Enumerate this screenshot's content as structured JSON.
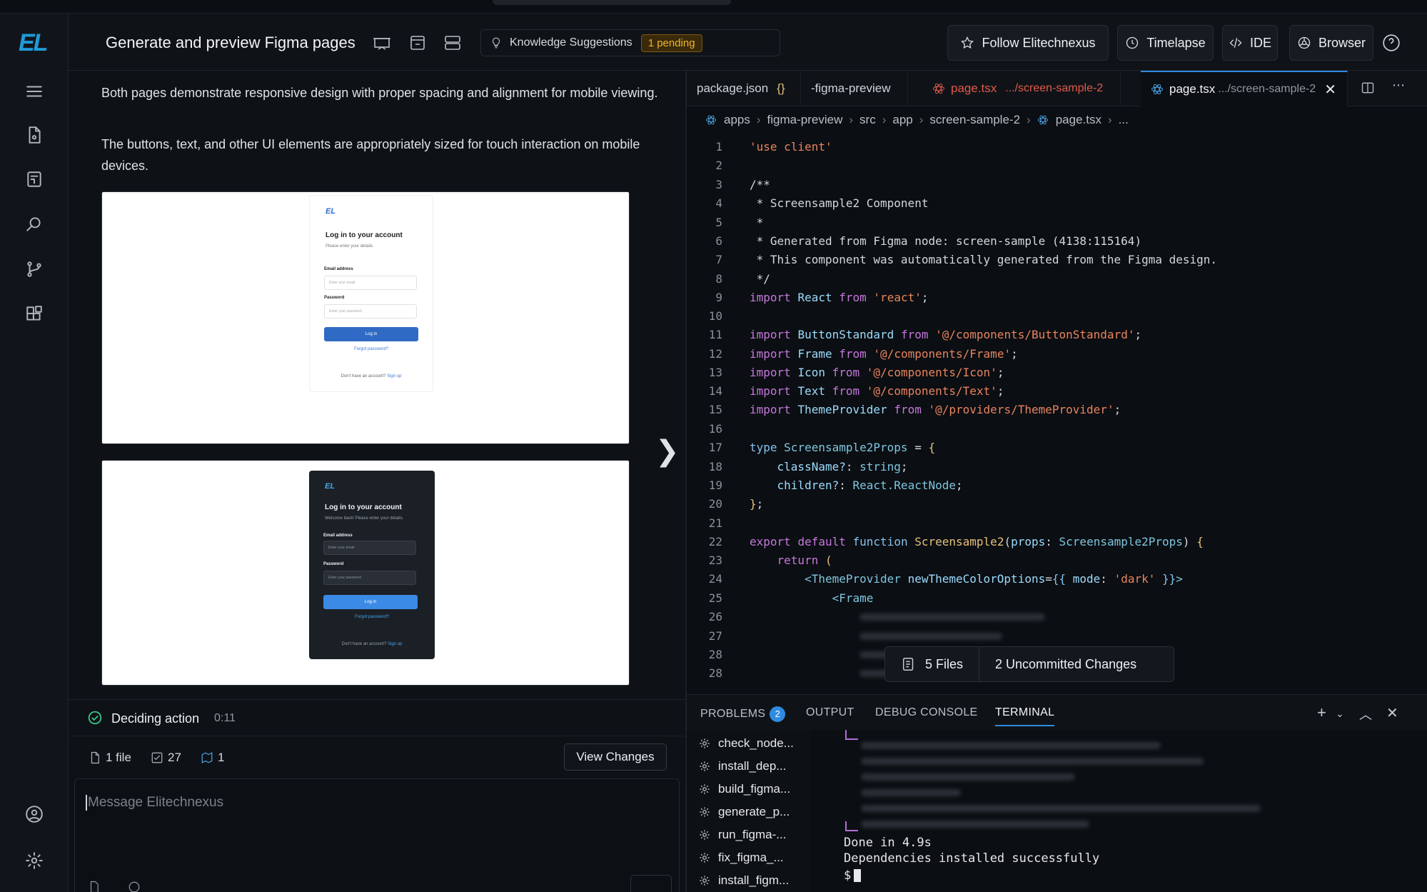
{
  "header": {
    "title": "Generate and preview Figma pages",
    "knowledge_label": "Knowledge Suggestions",
    "pending_badge": "1 pending",
    "follow_label": "Follow Elitechnexus",
    "timelapse_label": "Timelapse",
    "ide_label": "IDE",
    "browser_label": "Browser"
  },
  "brand": {
    "logo": "EL",
    "accent": "#1e9bd7"
  },
  "chat": {
    "paragraph1": "Both pages demonstrate responsive design with proper spacing and alignment for mobile viewing.",
    "paragraph2": "The buttons, text, and other UI elements are appropriately sized for touch interaction on mobile devices.",
    "preview_light": {
      "logo": "EL",
      "heading": "Log in to your account",
      "subheading": "Please enter your details.",
      "email_label": "Email address",
      "email_placeholder": "Enter your email",
      "password_label": "Password",
      "password_placeholder": "Enter your password",
      "button": "Log in",
      "forgot": "Forgot password?",
      "signup_prefix": "Don't have an account?",
      "signup_link": "Sign up"
    },
    "preview_dark": {
      "logo": "EL",
      "heading": "Log in to your account",
      "subheading": "Welcome back! Please enter your details.",
      "email_label": "Email address",
      "email_placeholder": "Enter your email",
      "password_label": "Password",
      "password_placeholder": "Enter your password",
      "button": "Log in",
      "forgot": "Forgot password?",
      "signup_prefix": "Don't have an account?",
      "signup_link": "Sign up"
    },
    "status_label": "Deciding action",
    "status_time": "0:11",
    "files_count": "1 file",
    "tasks_count": "27",
    "agents_count": "1",
    "view_changes": "View Changes",
    "composer_placeholder": "Message Elitechnexus"
  },
  "editor": {
    "tabs": [
      {
        "label": "package.json",
        "suffix": "{}"
      },
      {
        "label": "-figma-preview",
        "suffix": ""
      },
      {
        "label": "page.tsx",
        "suffix": ".../screen-sample-2"
      },
      {
        "label": "page.tsx",
        "suffix": ".../screen-sample-2"
      }
    ],
    "breadcrumb": [
      "apps",
      "figma-preview",
      "src",
      "app",
      "screen-sample-2",
      "page.tsx",
      "..."
    ],
    "line_numbers": [
      "1",
      "2",
      "3",
      "4",
      "5",
      "6",
      "7",
      "8",
      "9",
      "10",
      "11",
      "12",
      "13",
      "14",
      "15",
      "16",
      "17",
      "18",
      "19",
      "20",
      "21",
      "22",
      "23",
      "24",
      "25",
      "26",
      "27",
      "28",
      "28"
    ],
    "overlay_files": "5 Files",
    "overlay_changes": "2 Uncommitted Changes"
  },
  "panel": {
    "tabs": [
      "PROBLEMS",
      "OUTPUT",
      "DEBUG CONSOLE",
      "TERMINAL"
    ],
    "problems_count": "2",
    "tasks": [
      "check_node...",
      "install_dep...",
      "build_figma...",
      "generate_p...",
      "run_figma-...",
      "fix_figma_...",
      "install_figm..."
    ],
    "terminal_done": "Done in 4.9s",
    "terminal_deps": "Dependencies installed successfully",
    "terminal_prompt": "$"
  }
}
